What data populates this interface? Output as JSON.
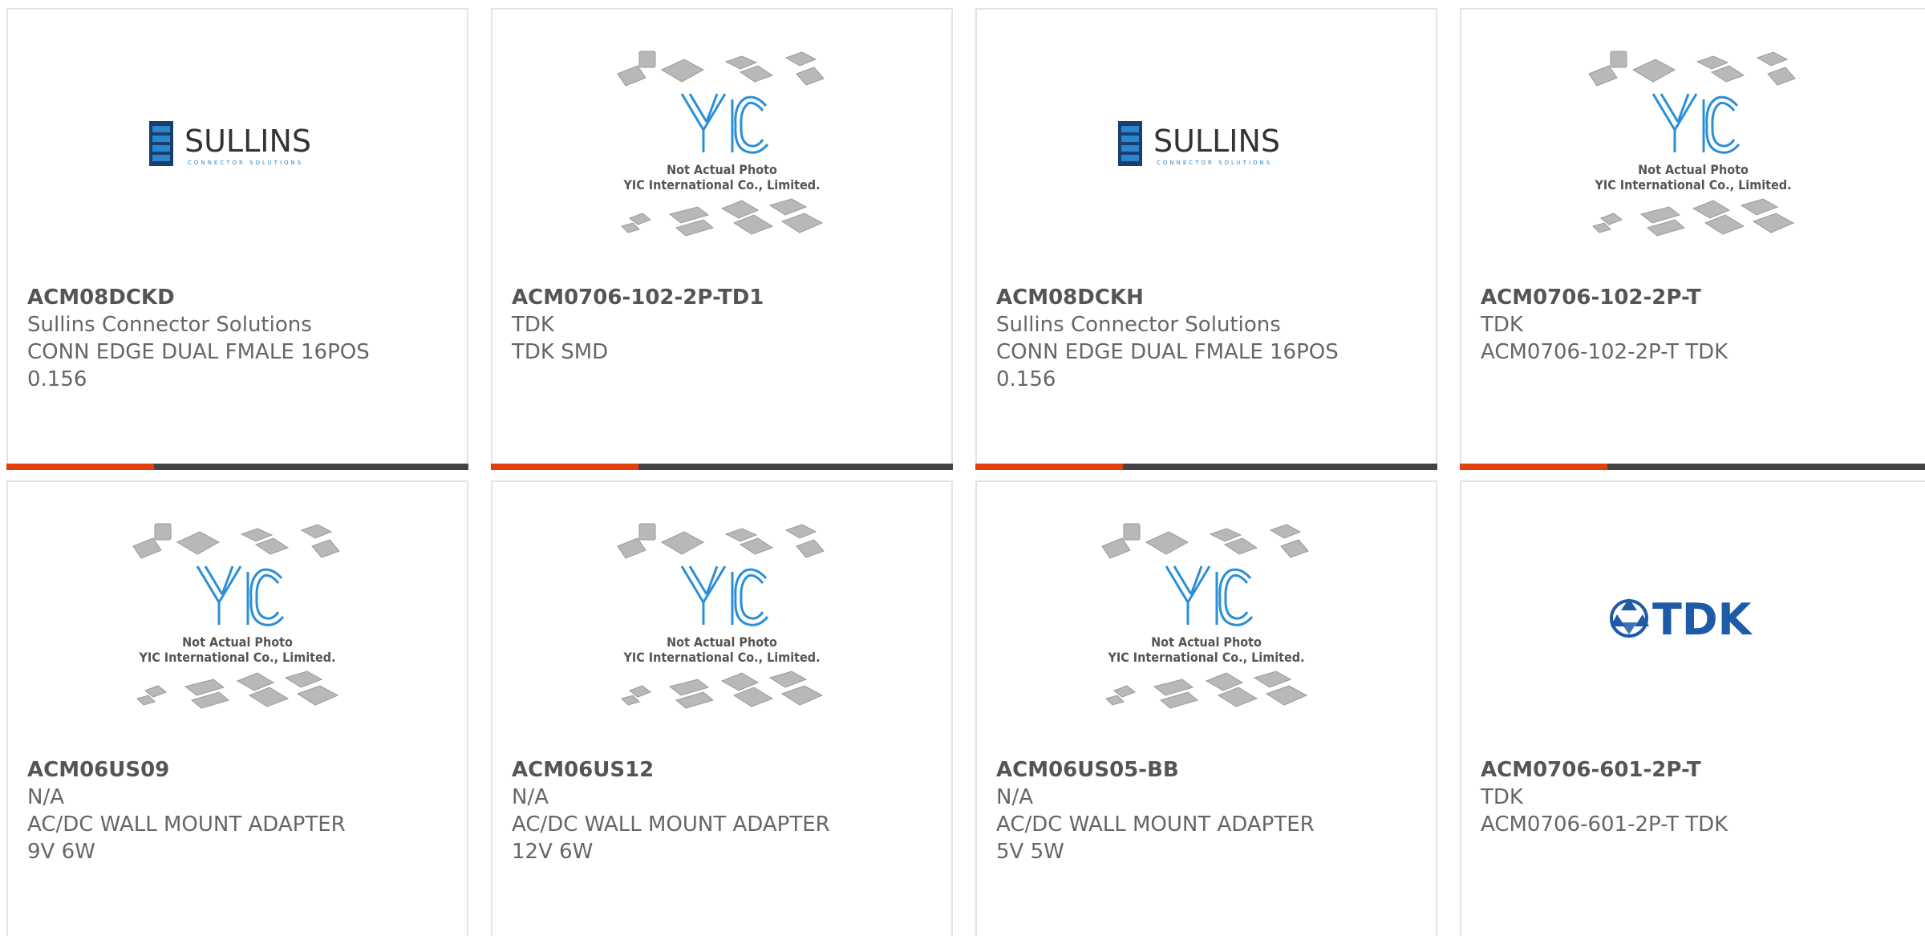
{
  "logo_text": {
    "sullins": "SULLINS",
    "sullins_sub": "CONNECTOR SOLUTIONS",
    "yic_line1": "Not Actual Photo",
    "yic_line2": "YIC International Co., Limited.",
    "tdk": "TDK"
  },
  "colors": {
    "accent": "#e0400e",
    "bar": "#444444",
    "sullins_blue": "#1a6fb5",
    "tdk_blue": "#1d5aa8",
    "yic_blue": "#2a8fd6"
  },
  "products": [
    {
      "image": "sullins-logo",
      "part_number": "ACM08DCKD",
      "manufacturer": "Sullins Connector Solutions",
      "desc1": "CONN EDGE DUAL FMALE 16POS",
      "desc2": "0.156"
    },
    {
      "image": "yic-placeholder",
      "part_number": "ACM0706-102-2P-TD1",
      "manufacturer": "TDK",
      "desc1": "TDK SMD",
      "desc2": ""
    },
    {
      "image": "sullins-logo",
      "part_number": "ACM08DCKH",
      "manufacturer": "Sullins Connector Solutions",
      "desc1": "CONN EDGE DUAL FMALE 16POS",
      "desc2": "0.156"
    },
    {
      "image": "yic-placeholder",
      "part_number": "ACM0706-102-2P-T",
      "manufacturer": "TDK",
      "desc1": "ACM0706-102-2P-T TDK",
      "desc2": ""
    },
    {
      "image": "yic-placeholder",
      "part_number": "ACM06US09",
      "manufacturer": "N/A",
      "desc1": "AC/DC WALL MOUNT ADAPTER",
      "desc2": "9V 6W"
    },
    {
      "image": "yic-placeholder",
      "part_number": "ACM06US12",
      "manufacturer": "N/A",
      "desc1": "AC/DC WALL MOUNT ADAPTER",
      "desc2": "12V 6W"
    },
    {
      "image": "yic-placeholder",
      "part_number": "ACM06US05-BB",
      "manufacturer": "N/A",
      "desc1": "AC/DC WALL MOUNT ADAPTER",
      "desc2": "5V 5W"
    },
    {
      "image": "tdk-logo",
      "part_number": "ACM0706-601-2P-T",
      "manufacturer": "TDK",
      "desc1": "ACM0706-601-2P-T TDK",
      "desc2": ""
    }
  ]
}
